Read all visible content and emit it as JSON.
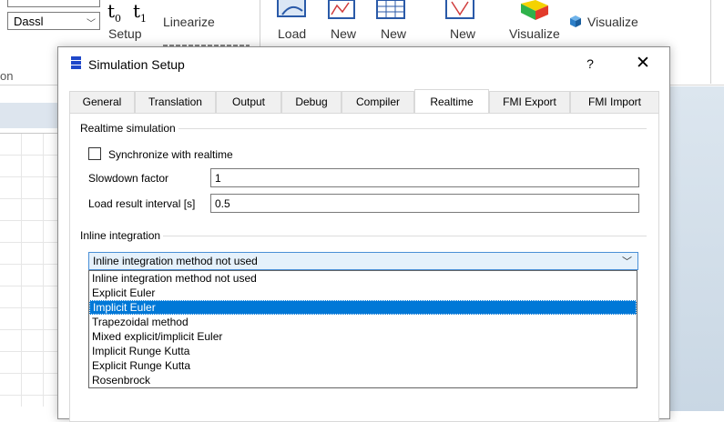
{
  "ribbon": {
    "solver_value": "Dassl",
    "t0": "t",
    "t0_sub": "0",
    "t1": "t",
    "t1_sub": "1",
    "setup_label": "Setup",
    "linearize_label": "Linearize",
    "load_label": "Load",
    "new_label_1": "New",
    "new_label_2": "New",
    "new_label_3": "New",
    "visualize_label": "Visualize",
    "visualize_small_label": "Visualize",
    "left_group_label": "on"
  },
  "dialog": {
    "title": "Simulation Setup",
    "help": "?",
    "close": "✕",
    "tabs": [
      {
        "label": "General"
      },
      {
        "label": "Translation"
      },
      {
        "label": "Output"
      },
      {
        "label": "Debug"
      },
      {
        "label": "Compiler"
      },
      {
        "label": "Realtime"
      },
      {
        "label": "FMI Export"
      },
      {
        "label": "FMI Import"
      }
    ],
    "active_tab": "Realtime",
    "realtime_group": {
      "title": "Realtime simulation",
      "sync_label": "Synchronize with realtime",
      "sync_checked": false,
      "slowdown_label": "Slowdown factor",
      "slowdown_value": "1",
      "load_interval_label": "Load result interval [s]",
      "load_interval_value": "0.5"
    },
    "inline_group": {
      "title": "Inline integration",
      "selected": "Inline integration method not used",
      "options": [
        "Inline integration method not used",
        "Explicit Euler",
        "Implicit Euler",
        "Trapezoidal method",
        "Mixed explicit/implicit Euler",
        "Implicit Runge Kutta",
        "Explicit Runge Kutta",
        "Rosenbrock"
      ],
      "highlighted": "Implicit Euler"
    }
  },
  "colors": {
    "accent": "#0078d7",
    "app_icon": "#1f47c9",
    "dropdown_bg": "#e5f1fb"
  }
}
